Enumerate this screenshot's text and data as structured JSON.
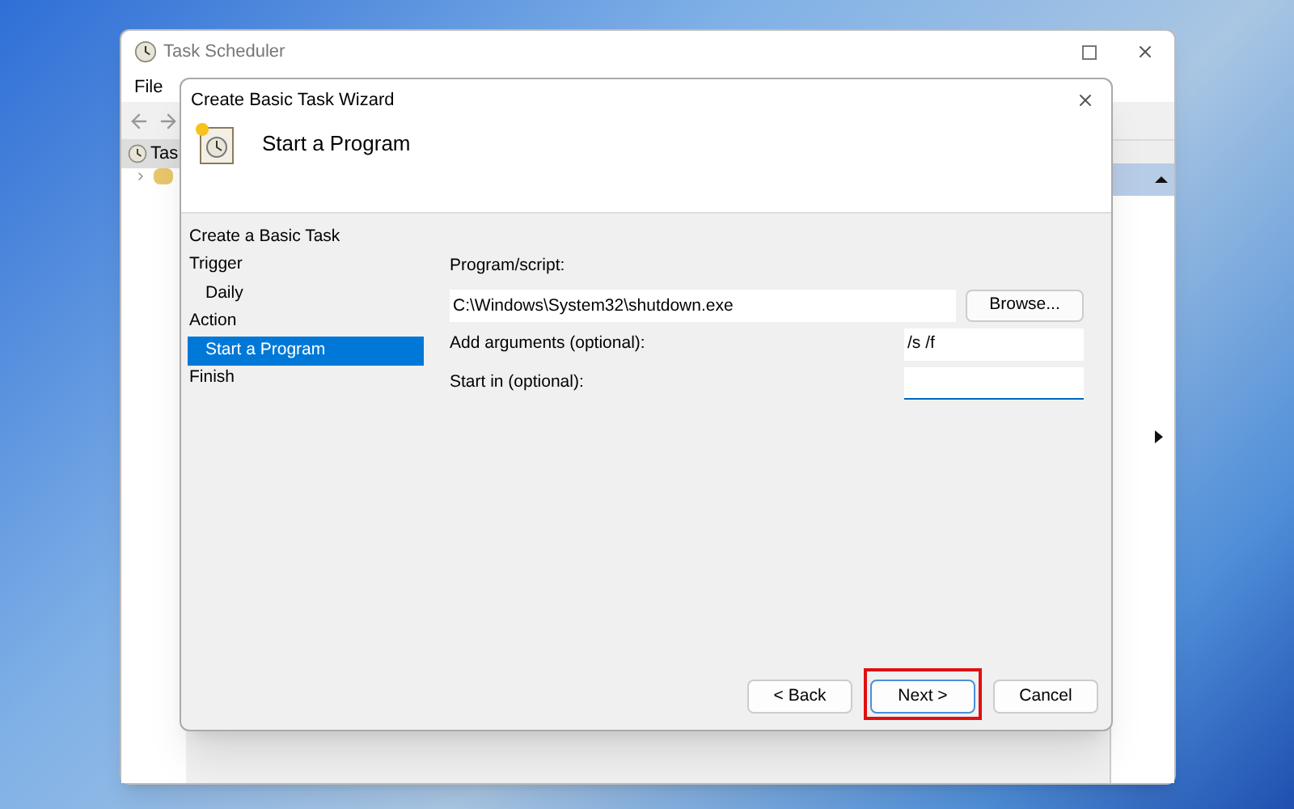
{
  "main_window": {
    "title": "Task Scheduler",
    "menu": [
      "File"
    ],
    "tree": [
      {
        "label": "Tas",
        "children": [
          {
            "kind": "folder"
          }
        ]
      }
    ]
  },
  "wizard": {
    "title": "Create Basic Task Wizard",
    "header": "Start a Program",
    "steps": [
      {
        "label": "Create a Basic Task",
        "selected": false
      },
      {
        "label": "Trigger",
        "selected": false,
        "children": [
          {
            "label": "Daily",
            "selected": false
          }
        ]
      },
      {
        "label": "Action",
        "selected": false,
        "children": [
          {
            "label": "Start a Program",
            "selected": true
          }
        ]
      },
      {
        "label": "Finish",
        "selected": false
      }
    ],
    "program": {
      "label": "Program/script:",
      "value": "C:\\Windows\\System32\\shutdown.exe",
      "browse": "Browse..."
    },
    "fields": [
      {
        "label": "Add arguments (optional):",
        "value": "/s /f",
        "focused": false
      },
      {
        "label": "Start in (optional):",
        "focused": true
      }
    ],
    "buttons": [
      {
        "label": "< Back",
        "default": false,
        "highlighted": false
      },
      {
        "label": "Next >",
        "default": true,
        "highlighted": true
      },
      {
        "label": "Cancel",
        "default": false,
        "highlighted": false
      }
    ]
  }
}
